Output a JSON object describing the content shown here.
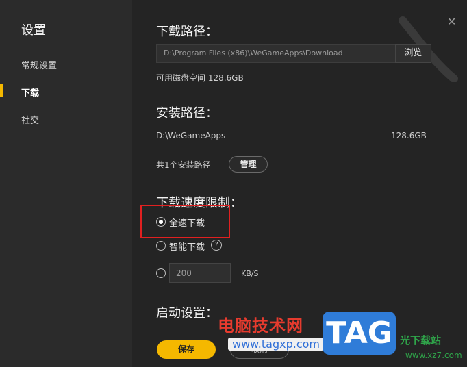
{
  "sidebar": {
    "title": "设置",
    "items": [
      {
        "label": "常规设置"
      },
      {
        "label": "下载"
      },
      {
        "label": "社交"
      }
    ]
  },
  "download_path": {
    "heading": "下载路径：",
    "value": "D:\\Program Files (x86)\\WeGameApps\\Download",
    "browse_label": "浏览",
    "free_space": "可用磁盘空间 128.6GB"
  },
  "install_path": {
    "heading": "安装路径：",
    "path": "D:\\WeGameApps",
    "size": "128.6GB",
    "count_text": "共1个安装路径",
    "manage_label": "管理"
  },
  "speed_limit": {
    "heading": "下载速度限制：",
    "options": [
      {
        "label": "全速下载",
        "selected": true
      },
      {
        "label": "智能下载",
        "selected": false
      }
    ],
    "help_icon": "question-circle-icon",
    "custom_value": "200",
    "unit": "KB/S"
  },
  "startup": {
    "heading": "启动设置："
  },
  "footer": {
    "save_label": "保存",
    "cancel_label": "取消"
  },
  "watermark": {
    "brand": "电脑技术网",
    "url": "www.tagxp.com",
    "tag": "TAG",
    "site": "光下载站",
    "site_url": "www.xz7.com"
  },
  "colors": {
    "accent": "#f5b800",
    "highlight_box": "#e02020",
    "background": "#242424",
    "sidebar": "#2b2b2b"
  }
}
